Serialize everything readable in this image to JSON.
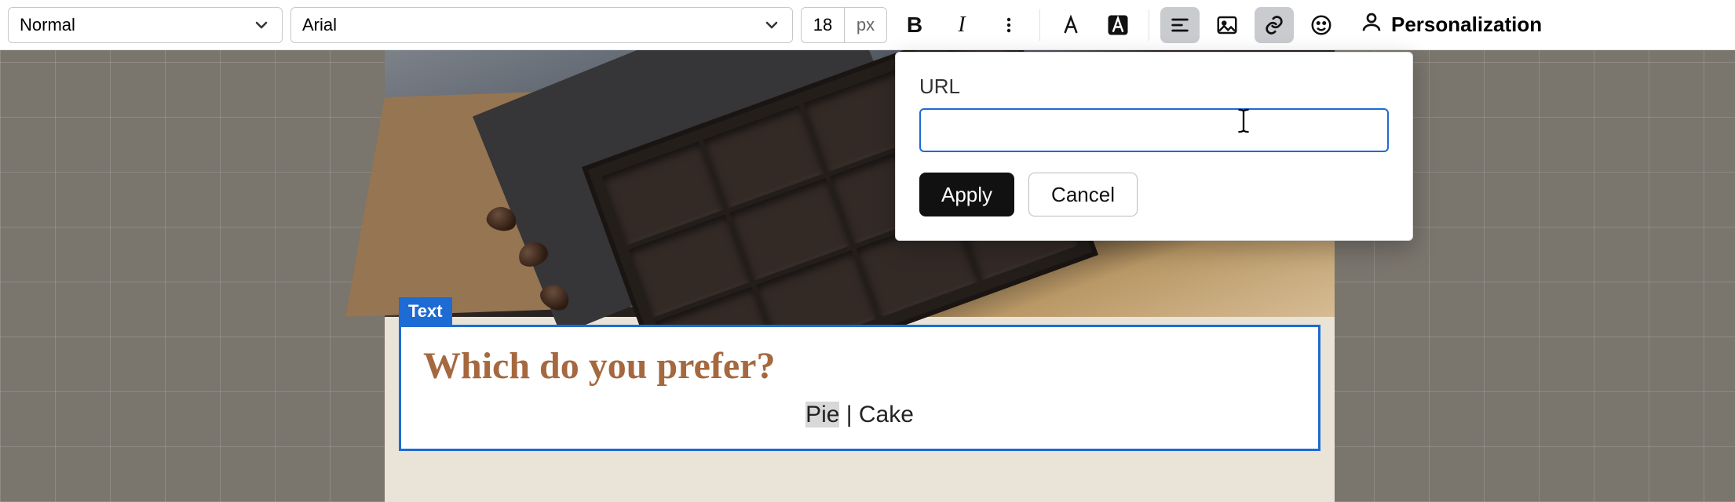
{
  "toolbar": {
    "format": "Normal",
    "font": "Arial",
    "font_size": "18",
    "font_unit": "px",
    "personalization_label": "Personalization"
  },
  "popover": {
    "label": "URL",
    "value": "",
    "apply_label": "Apply",
    "cancel_label": "Cancel"
  },
  "block": {
    "tag": "Text",
    "heading": "Which do you prefer?",
    "option_a": "Pie",
    "separator": " | ",
    "option_b": "Cake"
  },
  "colors": {
    "accent": "#1d6bd4",
    "heading": "#a5683f"
  }
}
